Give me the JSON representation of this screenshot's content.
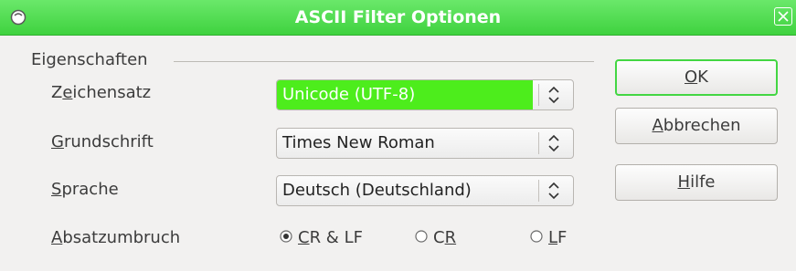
{
  "window": {
    "title": "ASCII Filter Optionen",
    "app_icon": "app-icon",
    "close_icon": "close-icon"
  },
  "properties": {
    "group_label": "Eigenschaften",
    "charset": {
      "mnemonic": "e",
      "label_pre": "Z",
      "label_post": "ichensatz",
      "value": "Unicode (UTF-8)"
    },
    "font": {
      "mnemonic": "G",
      "label_pre": "",
      "label_post": "rundschrift",
      "value": "Times New Roman"
    },
    "language": {
      "mnemonic": "S",
      "label_pre": "",
      "label_post": "prache",
      "value": "Deutsch (Deutschland)"
    },
    "paragraph_break": {
      "mnemonic": "A",
      "label_pre": "",
      "label_post": "bsatzumbruch",
      "options": [
        {
          "mnemonic": "C",
          "rest": "R & LF",
          "checked": true
        },
        {
          "prefix": "C",
          "mnemonic": "R",
          "rest": "",
          "checked": false
        },
        {
          "mnemonic": "L",
          "rest": "F",
          "checked": false
        }
      ]
    }
  },
  "buttons": {
    "ok": {
      "mnemonic": "O",
      "rest": "K"
    },
    "cancel": {
      "mnemonic": "A",
      "rest": "bbrechen"
    },
    "help": {
      "mnemonic": "H",
      "rest": "ilfe"
    }
  },
  "colors": {
    "titlebar": "#4ee04e",
    "selection": "#4ded1c",
    "default_button_border": "#43d643"
  }
}
